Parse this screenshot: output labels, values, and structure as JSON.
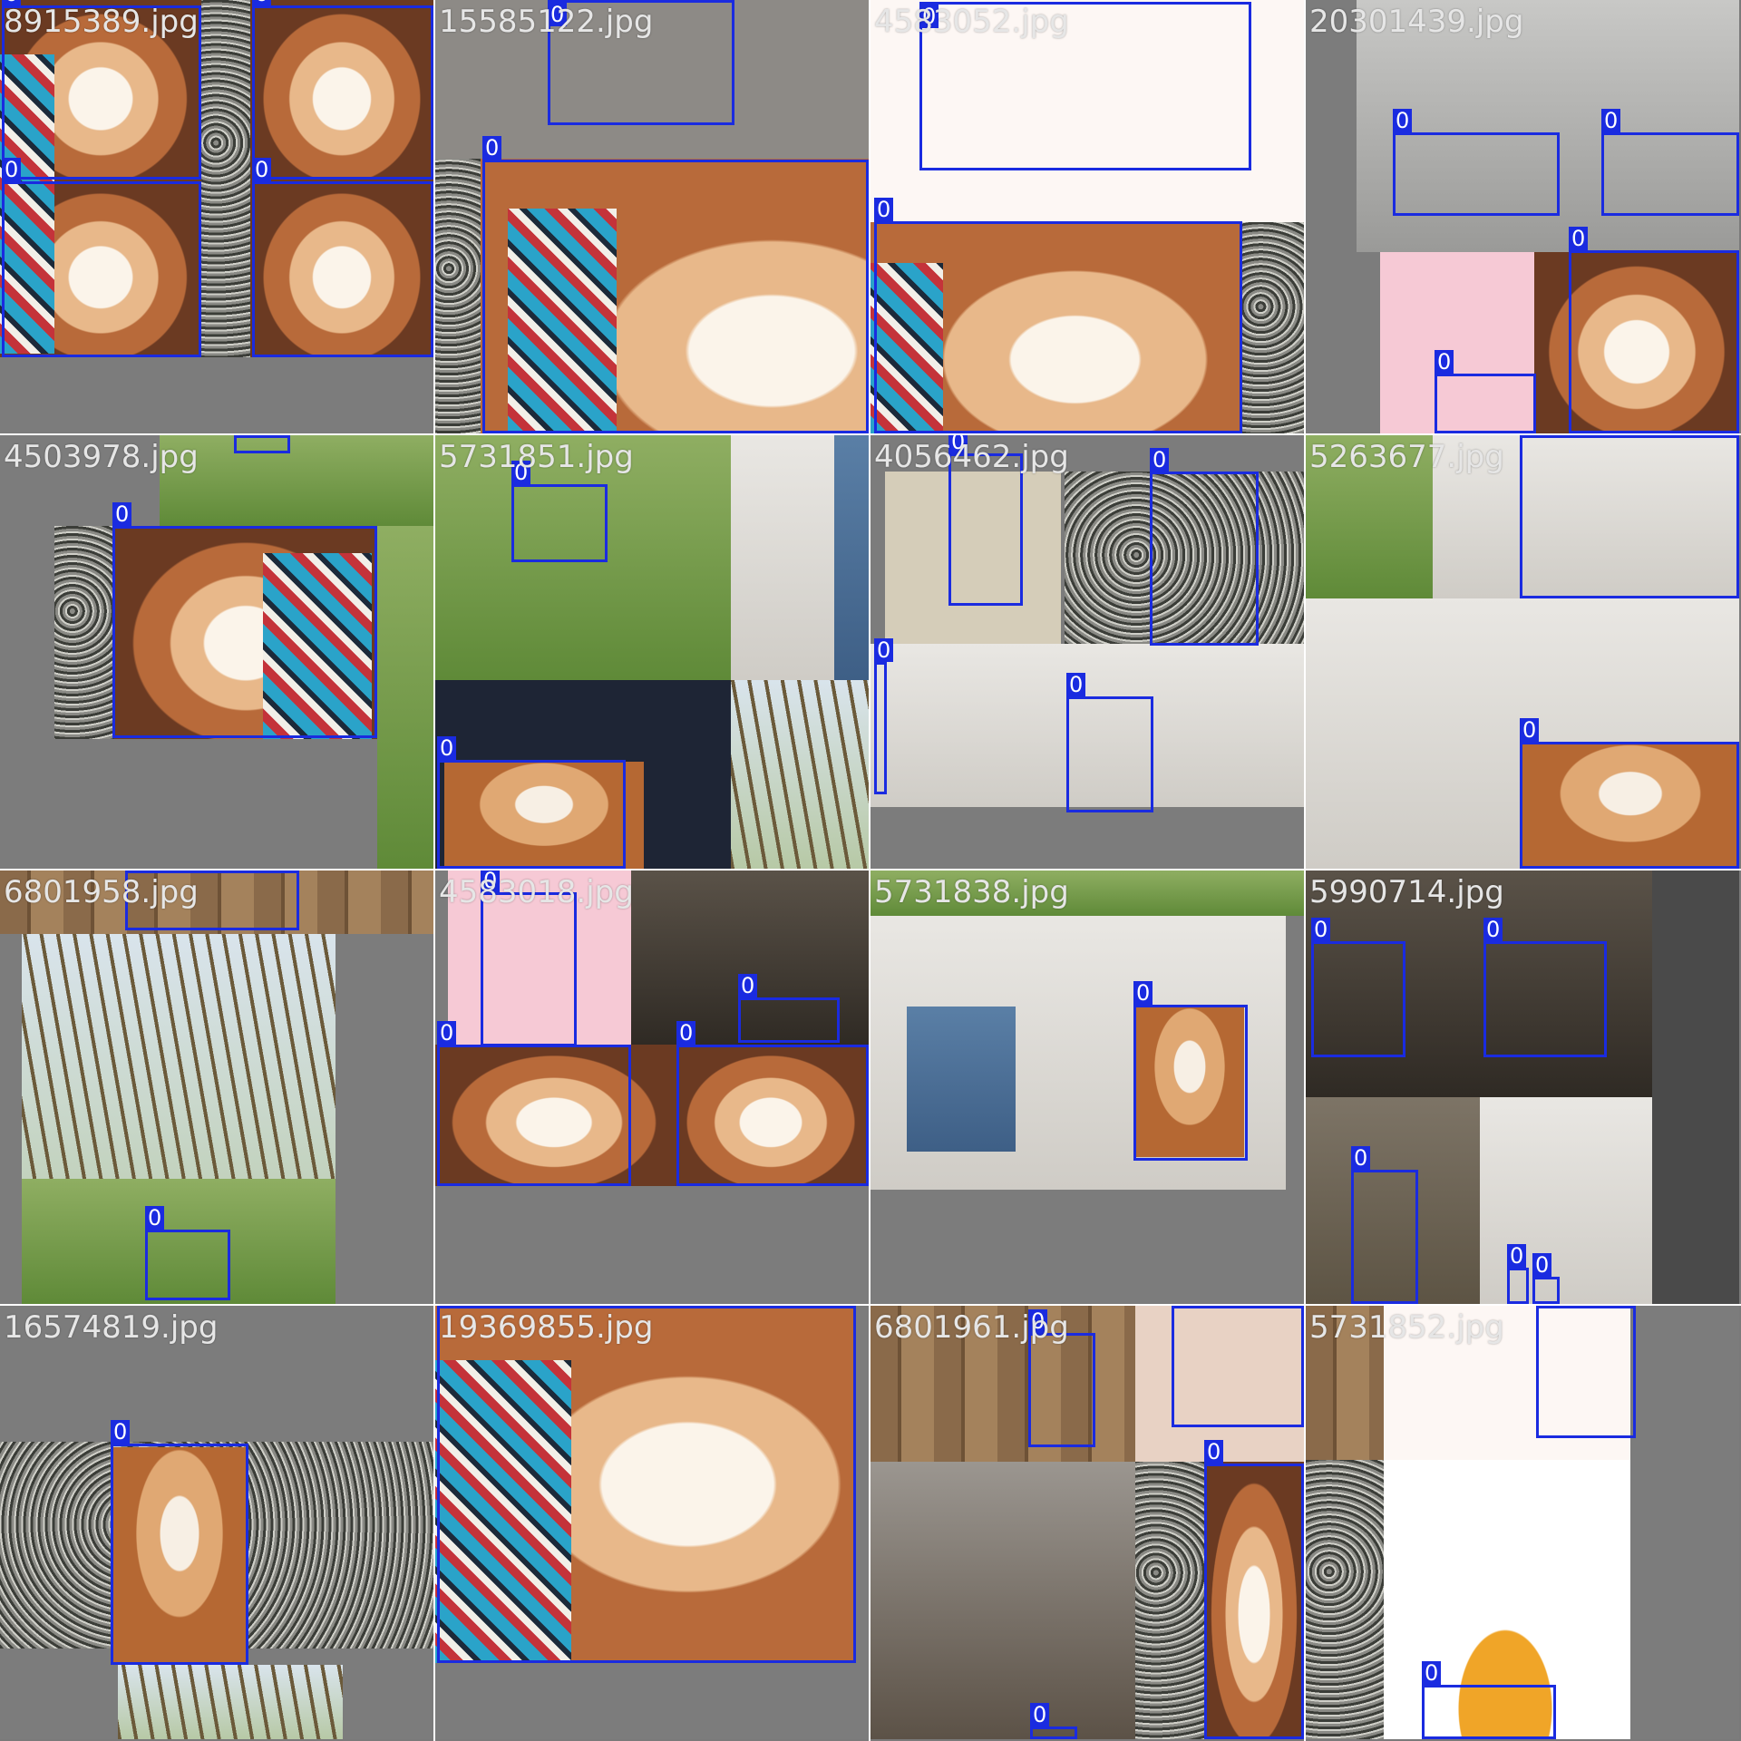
{
  "class_label": "0",
  "colors": {
    "box": "#1a2be0",
    "background": "#7a7a7a",
    "filename_text": "#e6e6e6"
  },
  "tiles": [
    {
      "filename": "8915389.jpg"
    },
    {
      "filename": "15585122.jpg"
    },
    {
      "filename": "4583052.jpg"
    },
    {
      "filename": "20301439.jpg"
    },
    {
      "filename": "4503978.jpg"
    },
    {
      "filename": "5731851.jpg"
    },
    {
      "filename": "4056462.jpg"
    },
    {
      "filename": "5263677.jpg"
    },
    {
      "filename": "6801958.jpg"
    },
    {
      "filename": "4583018.jpg"
    },
    {
      "filename": "5731838.jpg"
    },
    {
      "filename": "5990714.jpg"
    },
    {
      "filename": "16574819.jpg"
    },
    {
      "filename": "19369855.jpg"
    },
    {
      "filename": "6801961.jpg"
    },
    {
      "filename": "5731852.jpg"
    }
  ]
}
